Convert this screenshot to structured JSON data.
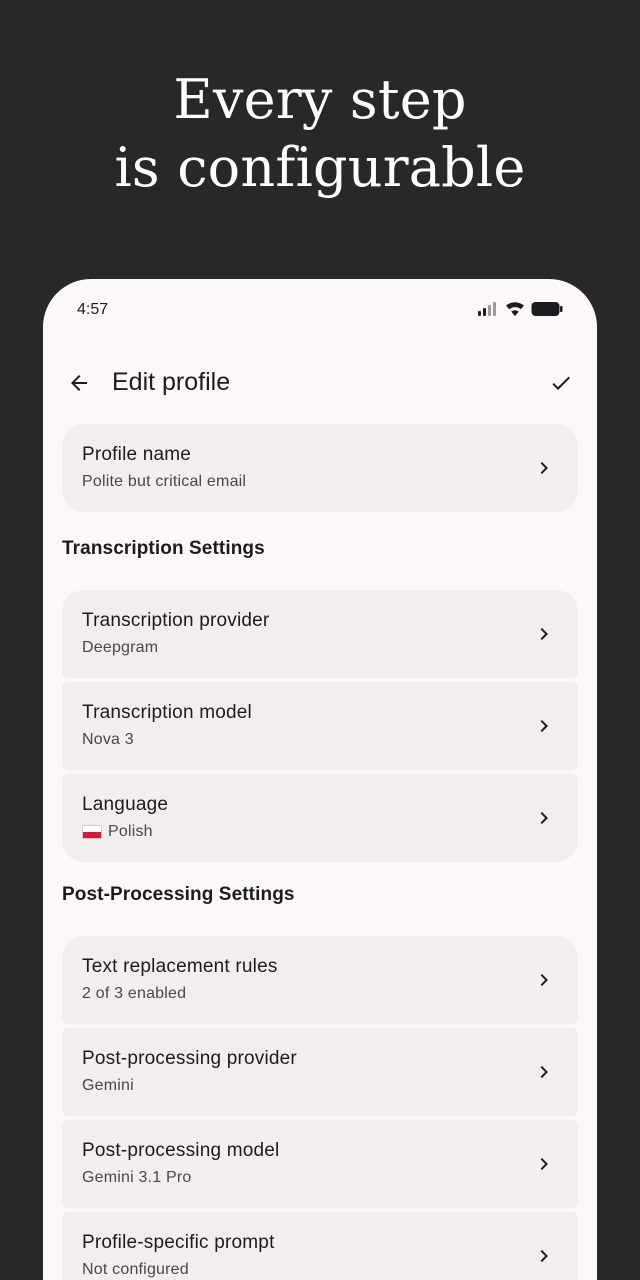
{
  "headline": {
    "line1": "Every step",
    "line2": "is configurable"
  },
  "status": {
    "time": "4:57"
  },
  "appbar": {
    "title": "Edit profile",
    "back_icon": "arrow-back-icon",
    "confirm_icon": "check-icon"
  },
  "profile": {
    "title": "Profile name",
    "value": "Polite but critical email"
  },
  "transcription": {
    "label": "Transcription Settings",
    "items": [
      {
        "title": "Transcription provider",
        "value": "Deepgram"
      },
      {
        "title": "Transcription model",
        "value": "Nova 3"
      },
      {
        "title": "Language",
        "value": "Polish",
        "flag": "poland-flag-icon"
      }
    ]
  },
  "post": {
    "label": "Post-Processing Settings",
    "items": [
      {
        "title": "Text replacement rules",
        "value": "2 of 3 enabled"
      },
      {
        "title": "Post-processing provider",
        "value": "Gemini"
      },
      {
        "title": "Post-processing model",
        "value": "Gemini 3.1 Pro"
      },
      {
        "title": "Profile-specific prompt",
        "value": "Not configured"
      }
    ]
  },
  "colors": {
    "background": "#282828",
    "surface": "#fcf8f7",
    "card": "#f1eeed",
    "text": "#1c1b1f",
    "subtext": "#4a4649",
    "flag_red": "#dc143c"
  }
}
